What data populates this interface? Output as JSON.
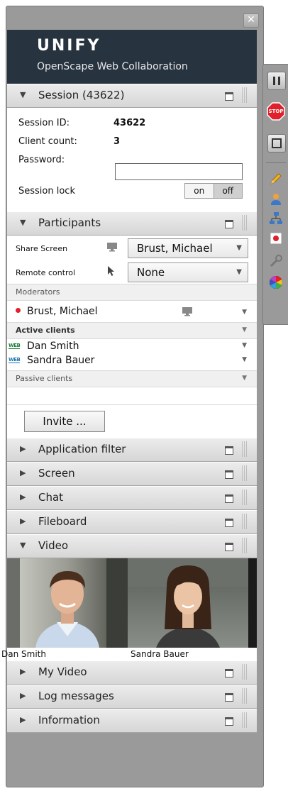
{
  "window": {
    "close_glyph": "✕"
  },
  "brand": {
    "logo": "UNIFY",
    "product": "OpenScape Web Collaboration"
  },
  "session": {
    "header": "Session (43622)",
    "id_label": "Session ID:",
    "id_value": "43622",
    "client_label": "Client count:",
    "client_value": "3",
    "password_label": "Password:",
    "password_value": "",
    "lock_label": "Session lock",
    "lock_on": "on",
    "lock_off": "off",
    "lock_state": "off"
  },
  "participants": {
    "header": "Participants",
    "share_label": "Share Screen",
    "share_value": "Brust, Michael",
    "remote_label": "Remote control",
    "remote_value": "None",
    "moderators_label": "Moderators",
    "moderators": [
      {
        "name": "Brust, Michael"
      }
    ],
    "active_label": "Active clients",
    "active": [
      {
        "badge": "WEB",
        "name": "Dan Smith"
      },
      {
        "badge": "WEB",
        "name": "Sandra Bauer"
      }
    ],
    "passive_label": "Passive clients",
    "invite_label": "Invite ..."
  },
  "sections": {
    "app_filter": "Application filter",
    "screen": "Screen",
    "chat": "Chat",
    "fileboard": "Fileboard",
    "video": "Video",
    "my_video": "My Video",
    "log": "Log messages",
    "info": "Information"
  },
  "video": {
    "tiles": [
      {
        "name": "Dan Smith"
      },
      {
        "name": "Sandra Bauer"
      }
    ]
  },
  "toolbar": {
    "pause": "pause-icon",
    "stop_label": "STOP",
    "stop": "stop-icon",
    "square": "square-icon",
    "pencil": "pencil-icon",
    "user": "user-icon",
    "network": "network-icon",
    "record": "record-icon",
    "wrench": "wrench-icon",
    "color": "color-wheel-icon"
  },
  "colors": {
    "brand_bg": "#273440",
    "accent_red": "#e0202a",
    "web_green": "#1a7f3a",
    "web_blue": "#1a77b5"
  }
}
